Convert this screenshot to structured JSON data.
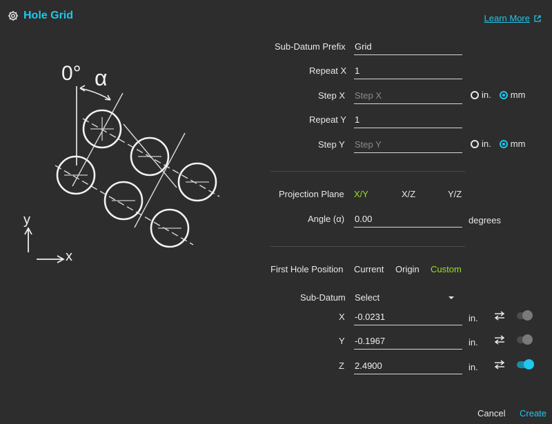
{
  "header": {
    "title": "Hole Grid",
    "learn_more": "Learn More"
  },
  "diagram": {
    "zero_label": "0°",
    "alpha_label": "α",
    "y_axis": "y",
    "x_axis": "x"
  },
  "form": {
    "sub_datum_prefix": {
      "label": "Sub-Datum Prefix",
      "value": "Grid"
    },
    "repeat_x": {
      "label": "Repeat X",
      "value": "1"
    },
    "step_x": {
      "label": "Step X",
      "placeholder": "Step X",
      "unit_in": "in.",
      "unit_mm": "mm",
      "selected": "mm"
    },
    "repeat_y": {
      "label": "Repeat Y",
      "value": "1"
    },
    "step_y": {
      "label": "Step Y",
      "placeholder": "Step Y",
      "unit_in": "in.",
      "unit_mm": "mm",
      "selected": "mm"
    },
    "projection": {
      "label": "Projection Plane",
      "options": [
        "X/Y",
        "X/Z",
        "Y/Z"
      ],
      "selected": "X/Y"
    },
    "angle": {
      "label": "Angle (α)",
      "value": "0.00",
      "unit": "degrees"
    },
    "first_hole": {
      "label": "First Hole Position",
      "options": [
        "Current",
        "Origin",
        "Custom"
      ],
      "selected": "Custom"
    },
    "sub_datum": {
      "label": "Sub-Datum",
      "value": "Select"
    },
    "coords": [
      {
        "axis": "X",
        "value": "-0.0231",
        "unit": "in.",
        "enabled": false
      },
      {
        "axis": "Y",
        "value": "-0.1967",
        "unit": "in.",
        "enabled": false
      },
      {
        "axis": "Z",
        "value": "2.4900",
        "unit": "in.",
        "enabled": true
      }
    ]
  },
  "footer": {
    "cancel": "Cancel",
    "create": "Create"
  },
  "colors": {
    "accent": "#1ec8ee",
    "active_option": "#9adf2a",
    "background": "#2d2d2d"
  },
  "icons": {
    "header": "gear-icon",
    "learn_more": "external-link-icon",
    "coord_action": "swap-arrows-icon"
  }
}
